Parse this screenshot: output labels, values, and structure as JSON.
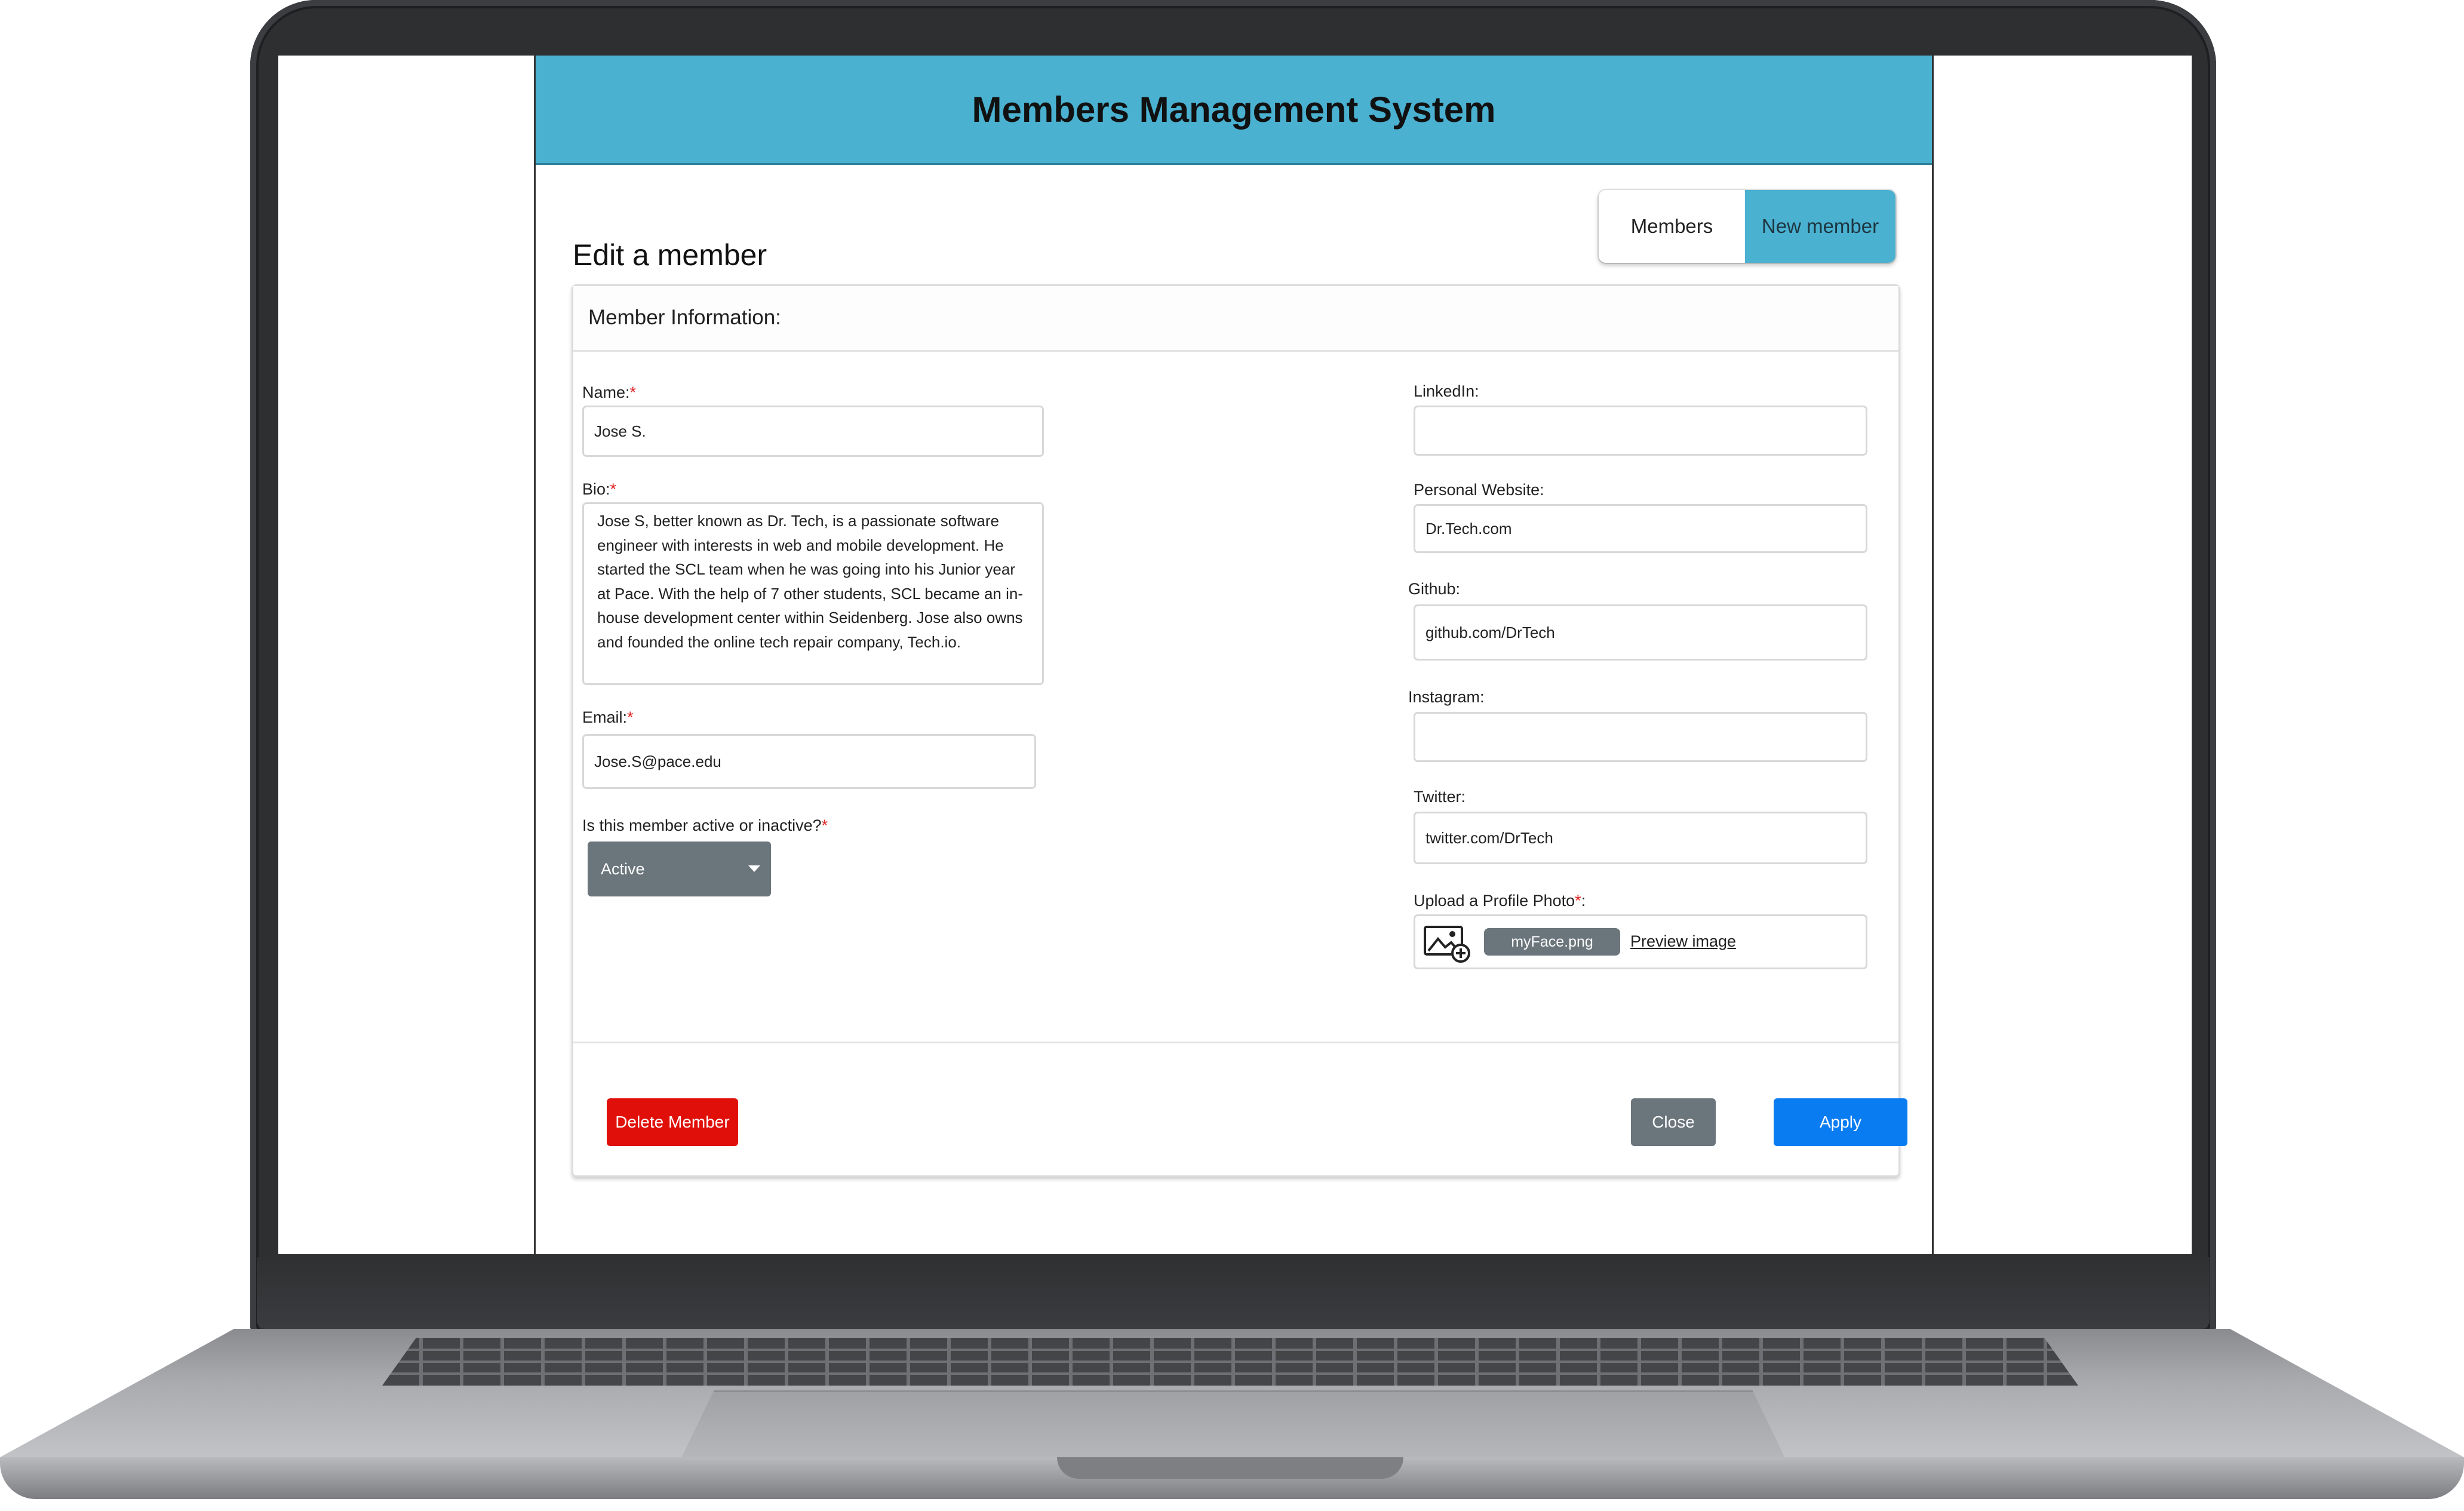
{
  "app": {
    "title": "Members Management System"
  },
  "nav": {
    "members_label": "Members",
    "new_member_label": "New member",
    "active_tab": "New member"
  },
  "page": {
    "title": "Edit a member"
  },
  "card": {
    "title": "Member Information:"
  },
  "form": {
    "name": {
      "label": "Name:",
      "required_mark": "*",
      "value": "Jose S."
    },
    "bio": {
      "label": "Bio:",
      "required_mark": "*",
      "value": "Jose S, better known as Dr. Tech, is a passionate software engineer with interests in web and mobile development. He started the SCL team when he was going into his Junior year at Pace. With the help of 7 other students, SCL became an in-house development center within Seidenberg. Jose also owns and founded the online tech repair company, Tech.io."
    },
    "email": {
      "label": "Email:",
      "required_mark": "*",
      "value": "Jose.S@pace.edu"
    },
    "status": {
      "label": "Is this member active or inactive?",
      "required_mark": "*",
      "value": "Active"
    },
    "linkedin": {
      "label": "LinkedIn:",
      "value": ""
    },
    "website": {
      "label": "Personal Website:",
      "value": "Dr.Tech.com"
    },
    "github": {
      "label": "Github:",
      "value": "github.com/DrTech"
    },
    "instagram": {
      "label": "Instagram:",
      "value": ""
    },
    "twitter": {
      "label": "Twitter:",
      "value": "twitter.com/DrTech"
    },
    "photo": {
      "label": "Upload a Profile Photo",
      "required_mark": "*",
      "label_suffix": ":",
      "file_name": "myFace.png",
      "preview_label": "Preview image",
      "icon": "image-upload-icon"
    }
  },
  "actions": {
    "delete_label": "Delete Member",
    "close_label": "Close",
    "apply_label": "Apply"
  },
  "colors": {
    "header": "#4ab1d1",
    "delete": "#e00f0a",
    "close": "#6b757c",
    "apply": "#0a7cf2",
    "required": "#e02020"
  }
}
